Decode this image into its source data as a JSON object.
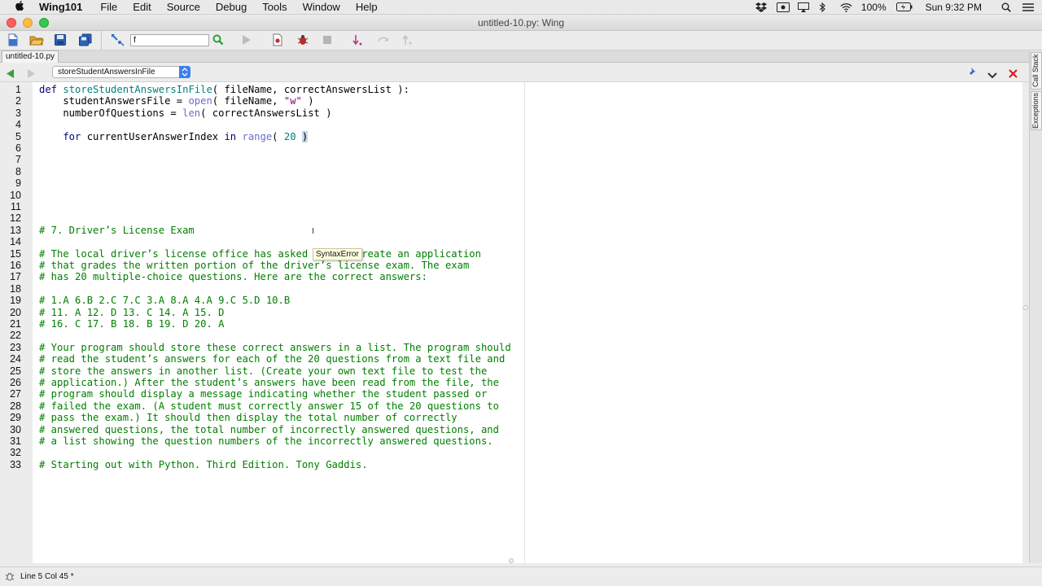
{
  "menubar": {
    "app_name": "Wing101",
    "menus": [
      "File",
      "Edit",
      "Source",
      "Debug",
      "Tools",
      "Window",
      "Help"
    ],
    "battery": "100%",
    "clock": "Sun 9:32 PM"
  },
  "window": {
    "title": "untitled-10.py: Wing"
  },
  "toolbar": {
    "search_value": "f"
  },
  "tabs": {
    "active_file": "untitled-10.py"
  },
  "nav": {
    "scope": "storeStudentAnswersInFile"
  },
  "editor": {
    "tooltip": "SyntaxError",
    "lines": [
      {
        "n": "1",
        "parts": [
          [
            "kw",
            "def "
          ],
          [
            "fn",
            "storeStudentAnswersInFile"
          ],
          [
            "",
            "( fileName, correctAnswersList ):"
          ]
        ]
      },
      {
        "n": "2",
        "parts": [
          [
            "",
            "    studentAnswersFile = "
          ],
          [
            "bi",
            "open"
          ],
          [
            "",
            "( fileName, "
          ],
          [
            "str",
            "\"w\""
          ],
          [
            "",
            " )"
          ]
        ]
      },
      {
        "n": "3",
        "parts": [
          [
            "",
            "    numberOfQuestions = "
          ],
          [
            "bi",
            "len"
          ],
          [
            "",
            "( correctAnswersList )"
          ]
        ]
      },
      {
        "n": "4",
        "parts": [
          [
            "",
            ""
          ]
        ]
      },
      {
        "n": "5",
        "parts": [
          [
            "kw",
            "    for "
          ],
          [
            "",
            "currentUserAnswerIndex "
          ],
          [
            "kw",
            "in "
          ],
          [
            "bi",
            "range"
          ],
          [
            "",
            "( "
          ],
          [
            "num",
            "20"
          ],
          [
            "",
            " "
          ],
          [
            "hl",
            ")"
          ]
        ]
      },
      {
        "n": "6",
        "parts": [
          [
            "",
            ""
          ]
        ]
      },
      {
        "n": "7",
        "parts": [
          [
            "",
            ""
          ]
        ]
      },
      {
        "n": "8",
        "parts": [
          [
            "",
            ""
          ]
        ]
      },
      {
        "n": "9",
        "parts": [
          [
            "",
            ""
          ]
        ]
      },
      {
        "n": "10",
        "parts": [
          [
            "",
            ""
          ]
        ]
      },
      {
        "n": "11",
        "parts": [
          [
            "",
            ""
          ]
        ]
      },
      {
        "n": "12",
        "parts": [
          [
            "",
            ""
          ]
        ]
      },
      {
        "n": "13",
        "parts": [
          [
            "cm",
            "# 7. Driver’s License Exam"
          ]
        ]
      },
      {
        "n": "14",
        "parts": [
          [
            "",
            ""
          ]
        ]
      },
      {
        "n": "15",
        "parts": [
          [
            "cm",
            "# The local driver’s license office has asked you to create an application"
          ]
        ]
      },
      {
        "n": "16",
        "parts": [
          [
            "cm",
            "# that grades the written portion of the driver’s license exam. The exam"
          ]
        ]
      },
      {
        "n": "17",
        "parts": [
          [
            "cm",
            "# has 20 multiple-choice questions. Here are the correct answers:"
          ]
        ]
      },
      {
        "n": "18",
        "parts": [
          [
            "",
            ""
          ]
        ]
      },
      {
        "n": "19",
        "parts": [
          [
            "cm",
            "# 1.A 6.B 2.C 7.C 3.A 8.A 4.A 9.C 5.D 10.B"
          ]
        ]
      },
      {
        "n": "20",
        "parts": [
          [
            "cm",
            "# 11. A 12. D 13. C 14. A 15. D"
          ]
        ]
      },
      {
        "n": "21",
        "parts": [
          [
            "cm",
            "# 16. C 17. B 18. B 19. D 20. A"
          ]
        ]
      },
      {
        "n": "22",
        "parts": [
          [
            "",
            ""
          ]
        ]
      },
      {
        "n": "23",
        "parts": [
          [
            "cm",
            "# Your program should store these correct answers in a list. The program should"
          ]
        ]
      },
      {
        "n": "24",
        "parts": [
          [
            "cm",
            "# read the student’s answers for each of the 20 questions from a text file and"
          ]
        ]
      },
      {
        "n": "25",
        "parts": [
          [
            "cm",
            "# store the answers in another list. (Create your own text file to test the"
          ]
        ]
      },
      {
        "n": "26",
        "parts": [
          [
            "cm",
            "# application.) After the student’s answers have been read from the file, the"
          ]
        ]
      },
      {
        "n": "27",
        "parts": [
          [
            "cm",
            "# program should display a message indicating whether the student passed or"
          ]
        ]
      },
      {
        "n": "28",
        "parts": [
          [
            "cm",
            "# failed the exam. (A student must correctly answer 15 of the 20 questions to"
          ]
        ]
      },
      {
        "n": "29",
        "parts": [
          [
            "cm",
            "# pass the exam.) It should then display the total number of correctly"
          ]
        ]
      },
      {
        "n": "30",
        "parts": [
          [
            "cm",
            "# answered questions, the total number of incorrectly answered questions, and"
          ]
        ]
      },
      {
        "n": "31",
        "parts": [
          [
            "cm",
            "# a list showing the question numbers of the incorrectly answered questions."
          ]
        ]
      },
      {
        "n": "32",
        "parts": [
          [
            "",
            ""
          ]
        ]
      },
      {
        "n": "33",
        "parts": [
          [
            "cm",
            "# Starting out with Python. Third Edition. Tony Gaddis."
          ]
        ]
      }
    ]
  },
  "side_panel": {
    "tab_call_stack": "Call Stack",
    "tab_exceptions": "Exceptions"
  },
  "status": {
    "text": "Line 5 Col 45 *"
  }
}
